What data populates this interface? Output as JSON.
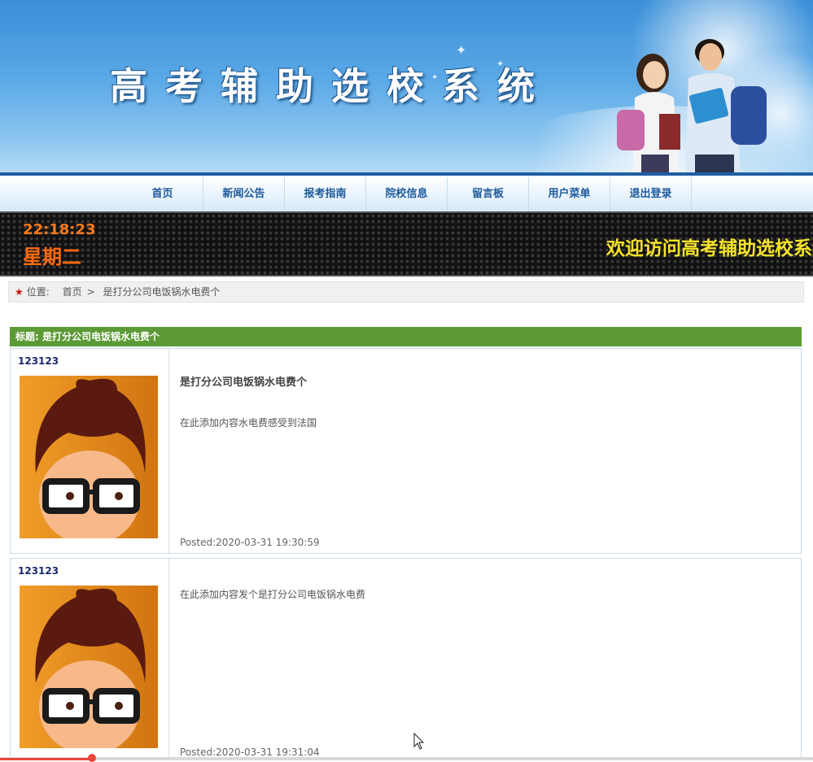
{
  "header": {
    "site_title": "高考辅助选校系统"
  },
  "nav": {
    "items": [
      "首页",
      "新闻公告",
      "报考指南",
      "院校信息",
      "留言板",
      "用户菜单",
      "退出登录"
    ]
  },
  "clock": {
    "time": "22:18:23",
    "weekday": "星期二"
  },
  "marquee": {
    "text": "欢迎访问高考辅助选校系统"
  },
  "breadcrumb": {
    "label": "位置:",
    "home": "首页",
    "separator": ">",
    "current": "是打分公司电饭锅水电费个"
  },
  "topic": {
    "title_label": "标题: 是打分公司电饭锅水电费个"
  },
  "posts": [
    {
      "username": "123123",
      "title": "是打分公司电饭锅水电费个",
      "content": "在此添加内容水电费感受到法国",
      "posted": "Posted:2020-03-31 19:30:59"
    },
    {
      "username": "123123",
      "title": "",
      "content": "在此添加内容发个是打分公司电饭锅水电费",
      "posted": "Posted:2020-03-31 19:31:04"
    }
  ],
  "colors": {
    "nav_text": "#1e5a9c",
    "topic_bar": "#5b9a35",
    "clock": "#ff7a1a",
    "marquee": "#f6e32a"
  },
  "icons": {
    "breadcrumb": "star-icon",
    "avatar": "cartoon-avatar-icon",
    "cursor": "mouse-cursor-icon"
  }
}
